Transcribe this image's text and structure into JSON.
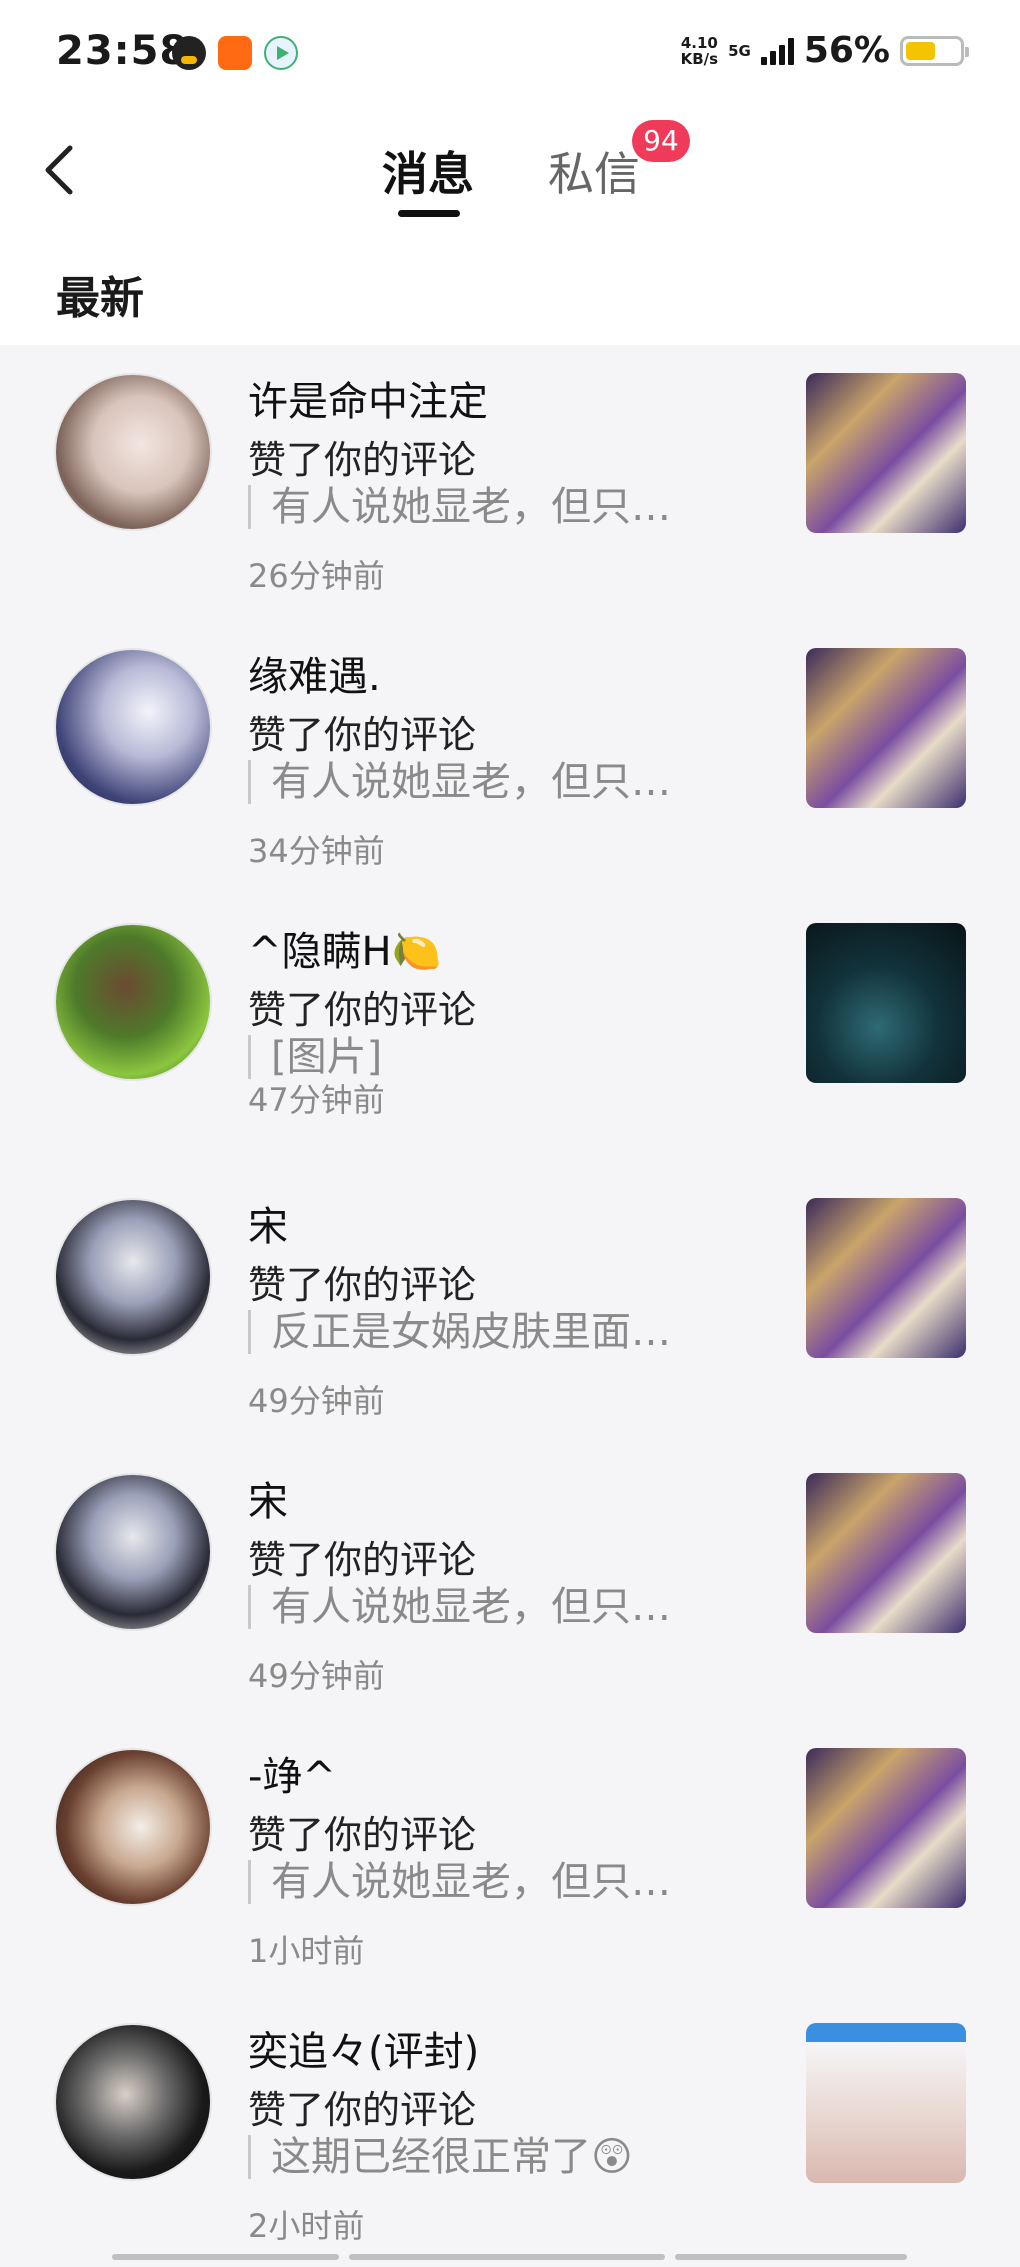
{
  "status_bar": {
    "time": "23:58",
    "net_speed_value": "4.10",
    "net_speed_unit": "KB/s",
    "network_type": "5G",
    "battery_percent": "56%",
    "battery_level": 0.56,
    "app_icons": [
      "qq-icon",
      "kuaishou-icon",
      "video-app-icon"
    ]
  },
  "header": {
    "tabs": [
      {
        "label": "消息",
        "active": true
      },
      {
        "label": "私信",
        "active": false,
        "badge": "94"
      }
    ]
  },
  "section": {
    "title": "最新"
  },
  "notifications": [
    {
      "name": "许是命中注定",
      "action": "赞了你的评论",
      "quote": "有人说她显老，但只…",
      "time": "26分钟前",
      "thumbnail": "hero-art"
    },
    {
      "name": "缘难遇.",
      "action": "赞了你的评论",
      "quote": "有人说她显老，但只…",
      "time": "34分钟前",
      "thumbnail": "hero-art"
    },
    {
      "name": "^隐瞒H🍋",
      "action": "赞了你的评论",
      "quote": "[图片]",
      "time": "47分钟前",
      "thumbnail": "night-scene"
    },
    {
      "name": "宋",
      "action": "赞了你的评论",
      "quote": "反正是女娲皮肤里面…",
      "time": "49分钟前",
      "thumbnail": "hero-art"
    },
    {
      "name": "宋",
      "action": "赞了你的评论",
      "quote": "有人说她显老，但只…",
      "time": "49分钟前",
      "thumbnail": "hero-art"
    },
    {
      "name": "-竫^",
      "action": "赞了你的评论",
      "quote": "有人说她显老，但只…",
      "time": "1小时前",
      "thumbnail": "hero-art"
    },
    {
      "name": "奕追々(评封)",
      "action": "赞了你的评论",
      "quote": "这期已经很正常了😲",
      "time": "2小时前",
      "thumbnail": "stream-screenshot"
    }
  ],
  "colors": {
    "accent_badge": "#f03a5a",
    "background": "#f5f5f7",
    "muted_text": "#8a8a8a"
  }
}
